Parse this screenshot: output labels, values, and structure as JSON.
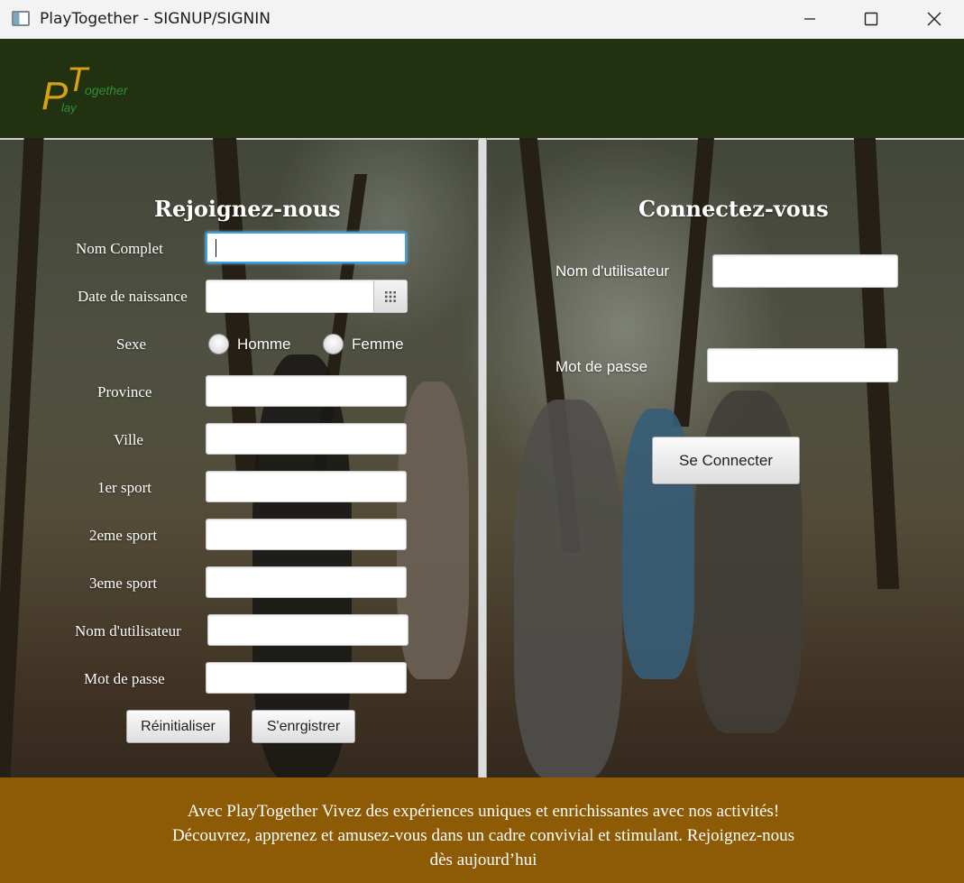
{
  "window": {
    "title": "PlayTogether - SIGNUP/SIGNIN"
  },
  "logo": {
    "big_p": "P",
    "big_t": "T",
    "small_lay": "lay",
    "small_ogether": "ogether",
    "colors": {
      "p": "#d7a016",
      "together": "#2f8f3a"
    }
  },
  "signup": {
    "heading": "Rejoignez-nous",
    "labels": {
      "full_name": "Nom Complet",
      "birth_date": "Date de naissance",
      "sex": "Sexe",
      "province": "Province",
      "city": "Ville",
      "sport1": "1er sport",
      "sport2": "2eme sport",
      "sport3": "3eme sport",
      "username": "Nom d'utilisateur",
      "password": "Mot de passe"
    },
    "values": {
      "full_name": "",
      "birth_date": "",
      "province": "",
      "city": "",
      "sport1": "",
      "sport2": "",
      "sport3": "",
      "username": "",
      "password": ""
    },
    "sex_options": {
      "male": "Homme",
      "female": "Femme"
    },
    "reset_label": "Réinitialiser",
    "register_label": "S'enrgistrer"
  },
  "signin": {
    "heading": "Connectez-vous",
    "labels": {
      "username": "Nom d'utilisateur",
      "password": "Mot de passe"
    },
    "values": {
      "username": "",
      "password": ""
    },
    "connect_label": "Se Connecter"
  },
  "footer": {
    "text": "Avec PlayTogether Vivez des expériences uniques et enrichissantes avec nos activités! Découvrez, apprenez et amusez-vous dans un cadre convivial et stimulant. Rejoignez-nous dès aujourd’hui"
  },
  "colors": {
    "header_bg": "#22310f",
    "footer_bg": "#8d5a05",
    "focus": "#3aa3e3"
  }
}
